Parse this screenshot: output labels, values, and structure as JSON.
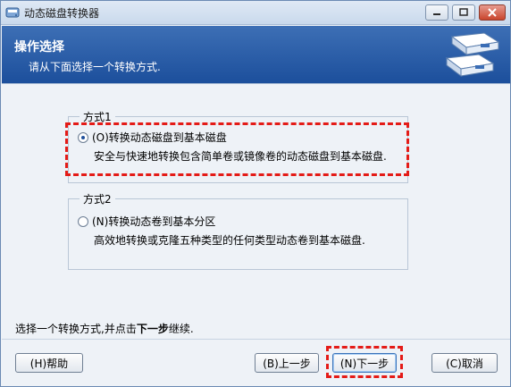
{
  "window": {
    "title": "动态磁盘转换器"
  },
  "header": {
    "title": "操作选择",
    "subtitle": "请从下面选择一个转换方式."
  },
  "options": [
    {
      "group_label": "方式1",
      "radio_label": "(O)转换动态磁盘到基本磁盘",
      "description": "安全与快速地转换包含简单卷或镜像卷的动态磁盘到基本磁盘.",
      "selected": true
    },
    {
      "group_label": "方式2",
      "radio_label": "(N)转换动态卷到基本分区",
      "description": "高效地转换或克隆五种类型的任何类型动态卷到基本磁盘.",
      "selected": false
    }
  ],
  "footer": {
    "prefix": "选择一个转换方式,并点击",
    "emphasis": "下一步",
    "suffix": "继续."
  },
  "buttons": {
    "help": "(H)帮助",
    "prev": "(B)上一步",
    "next": "(N)下一步",
    "cancel": "(C)取消"
  },
  "colors": {
    "header_blue": "#1c4f9c",
    "highlight_red": "#e41b17"
  },
  "icons": {
    "app": "app-disk-icon",
    "header": "disks-icon"
  }
}
